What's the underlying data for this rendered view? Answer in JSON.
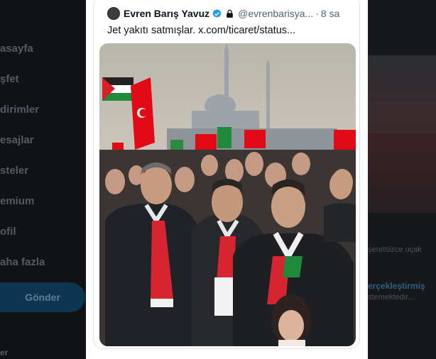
{
  "nav": {
    "items": [
      "asayfa",
      "şfet",
      "dirimler",
      "esajlar",
      "steler",
      "emium",
      "ofil",
      "aha fazla"
    ],
    "post_button": "Gönder",
    "bottom_label": "er"
  },
  "tweet": {
    "author_name": "Evren Barış Yavuz",
    "handle": "@evrenbarisya...",
    "separator": "·",
    "time": "8 sa",
    "text": "Jet yakıtı satmışlar. x.com/ticaret/status...",
    "verified_icon": "verified-badge-icon",
    "lock_icon": "lock-icon",
    "media_description_icon": "photo-crowd-with-flags"
  },
  "right_panel": {
    "fragment_1": "şeretsizce uçak",
    "fragment_2": "erçekleştirmiş",
    "fragment_3": "stemektedir..."
  },
  "colors": {
    "accent_blue": "#1d9bf0",
    "turkish_flag_red": "#e30a17",
    "text_primary": "#0f1419",
    "text_secondary": "#536471"
  }
}
